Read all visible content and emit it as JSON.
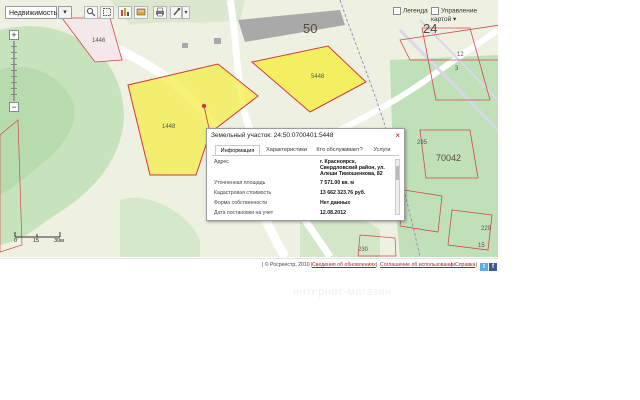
{
  "toolbar": {
    "layer_select_value": "Недвижимость",
    "layer_select_arrow": "▾",
    "legend_label": "Легенда",
    "map_control_label": "Управление картой",
    "map_control_arrow": "▾"
  },
  "zoom": {
    "plus": "+",
    "minus": "−"
  },
  "scale": {
    "zero": "0",
    "mid": "15",
    "max": "30м"
  },
  "map_labels": {
    "big_50": "50",
    "big_24": "24",
    "big_70042": "70042",
    "p1446": "1446",
    "p1448": "1448",
    "p5448": "5448",
    "p295": "295",
    "p229": "229",
    "p230": "230",
    "p15": "15",
    "p3": "3",
    "p12": "12"
  },
  "popup": {
    "title": "Земельный участок: 24:50:0700401:5448",
    "close": "×",
    "tabs": [
      {
        "label": "Информация",
        "active": true
      },
      {
        "label": "Характеристики",
        "active": false
      },
      {
        "label": "Кто обслуживает?",
        "active": false
      },
      {
        "label": "Услуги",
        "active": false
      }
    ],
    "rows": [
      {
        "label": "Адрес",
        "value_lines": [
          "г. Красноярск,",
          "Свердловский район, ул.",
          "Алеши Тимошенкова, 82"
        ]
      },
      {
        "label": "Уточненная площадь",
        "value_lines": [
          "7 571.00 кв. м"
        ]
      },
      {
        "label": "Кадастровая стоимость",
        "value_lines": [
          "13 662 323.76 руб."
        ]
      },
      {
        "label": "Форма собственности",
        "value_lines": [
          "Нет данных"
        ]
      },
      {
        "label": "Дата постановки на учет",
        "value_lines": [
          "12.08.2012"
        ]
      }
    ]
  },
  "footer": {
    "copyright": "| © Росреестр, 2010 |",
    "link1": "Сведения об обновлениях",
    "sep1": "|",
    "link2": "Соглашение об использовании",
    "sep2": "|",
    "link3": "Справка",
    "sep3": "|",
    "twitter": "t",
    "facebook": "f"
  },
  "watermark": "интернет-магазин",
  "colors": {
    "parcel_fill": "#f4ee4a",
    "parcel_border": "#d03a3a",
    "green": "#bfe0b8",
    "road": "#ffffff",
    "building": "#a9a9a9",
    "accent_link": "#b02020",
    "twitter": "#55acee",
    "facebook": "#3b5998"
  }
}
